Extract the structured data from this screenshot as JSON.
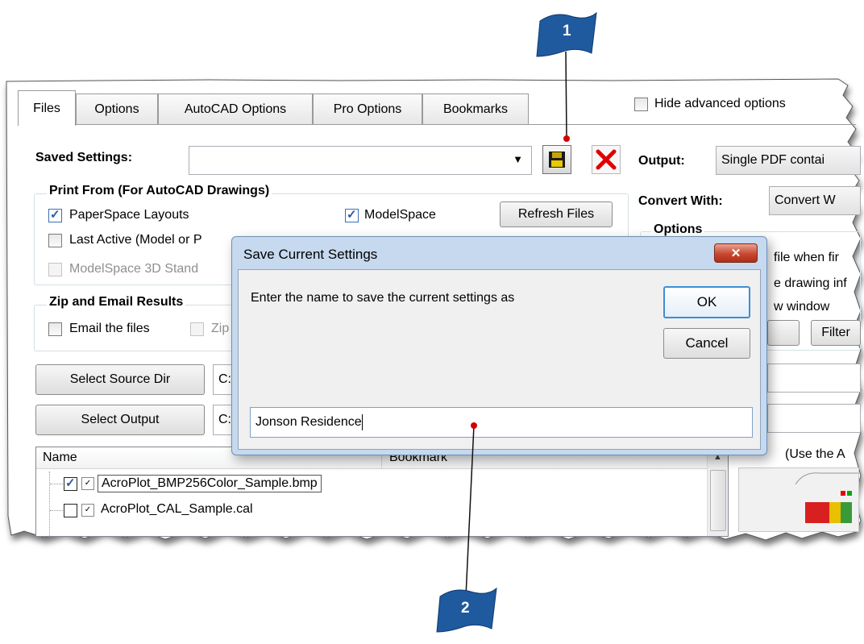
{
  "tabs": [
    "Files",
    "Options",
    "AutoCAD Options",
    "Pro Options",
    "Bookmarks"
  ],
  "hide_advanced_label": "Hide advanced options",
  "saved_settings": {
    "label": "Saved Settings:",
    "value": ""
  },
  "output": {
    "label": "Output:",
    "value": "Single PDF contai"
  },
  "convert_with": {
    "label": "Convert With:",
    "value": "Convert W"
  },
  "options_group_title": "Options",
  "right_options": [
    "file when fir",
    "e drawing inf",
    "w window"
  ],
  "filter_button": "Filter",
  "print_from": {
    "title": "Print From (For AutoCAD Drawings)",
    "paperspace": "PaperSpace Layouts",
    "modelspace": "ModelSpace",
    "last_active": "Last Active (Model or P",
    "modelspace_3d": "ModelSpace 3D Stand",
    "refresh_button": "Refresh Files"
  },
  "zip_email": {
    "title": "Zip and Email Results",
    "email_files": "Email the files",
    "zip": "Zip"
  },
  "select_source_button": "Select Source Dir",
  "select_source_value": "C:",
  "select_output_button": "Select Output",
  "select_output_value": "C:",
  "file_list": {
    "col_name": "Name",
    "col_bookmark": "Bookmark",
    "rows": [
      "AcroPlot_BMP256Color_Sample.bmp",
      "AcroPlot_CAL_Sample.cal"
    ]
  },
  "use_the_text": "(Use the A",
  "dialog": {
    "title": "Save Current Settings",
    "prompt": "Enter the name to save the current settings as",
    "ok": "OK",
    "cancel": "Cancel",
    "input_value": "Jonson Residence"
  },
  "callouts": [
    "1",
    "2"
  ],
  "colors": {
    "callout_blue": "#1f5a9e",
    "accent_red": "#d40000",
    "dialog_frame": "#c6d9ee"
  }
}
